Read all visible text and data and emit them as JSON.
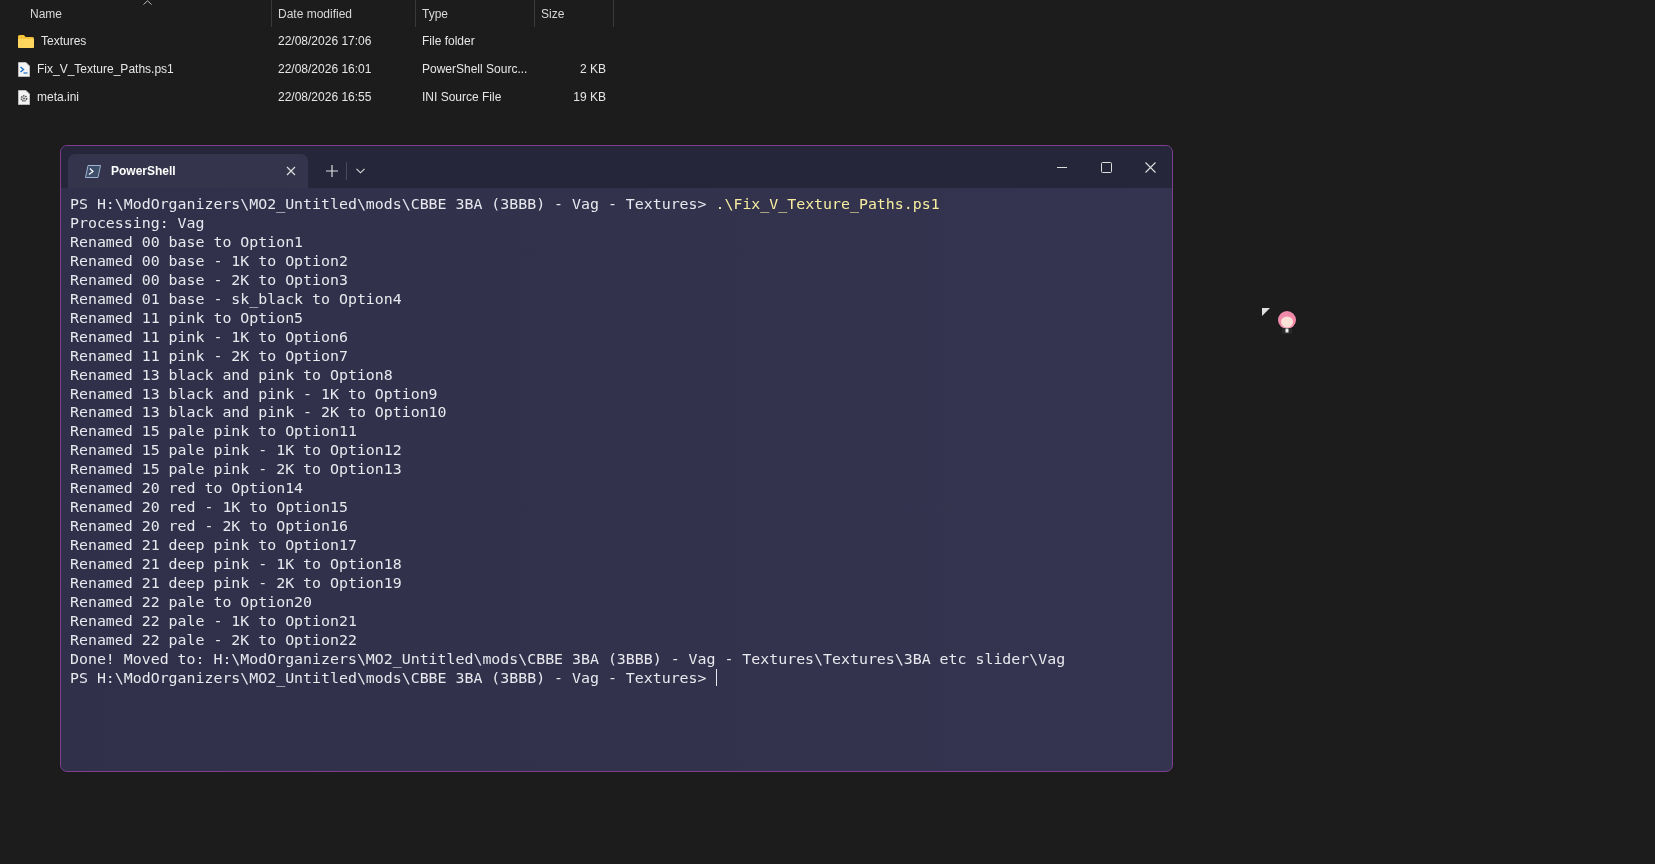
{
  "explorer": {
    "columns": [
      {
        "label": "Name",
        "sorted": true
      },
      {
        "label": "Date modified",
        "sorted": false
      },
      {
        "label": "Type",
        "sorted": false
      },
      {
        "label": "Size",
        "sorted": false
      }
    ],
    "rows": [
      {
        "kind": "folder",
        "name": "Textures",
        "date": "22/08/2026 17:06",
        "type": "File folder"
      },
      {
        "kind": "script",
        "name": "Fix_V_Texture_Paths.ps1",
        "date": "22/08/2026 16:01",
        "type": "PowerShell Sourc...",
        "size": "2 KB"
      },
      {
        "kind": "settings",
        "name": "meta.ini",
        "date": "22/08/2026 16:55",
        "type": "INI Source File",
        "size": "19 KB"
      }
    ]
  },
  "terminal": {
    "tab": {
      "title": "PowerShell",
      "selected": true
    },
    "lines": [
      {
        "kind": "prompt",
        "prompt": "PS H:\\ModOrganizers\\MO2_Untitled\\mods\\CBBE 3BA (3BBB) - Vag - Textures> ",
        "command": ".\\Fix_V_Texture_Paths.ps1",
        "cursor": false
      },
      {
        "kind": "output",
        "text": "Processing: Vag"
      },
      {
        "kind": "output",
        "text": "Renamed 00 base to Option1"
      },
      {
        "kind": "output",
        "text": "Renamed 00 base - 1K to Option2"
      },
      {
        "kind": "output",
        "text": "Renamed 00 base - 2K to Option3"
      },
      {
        "kind": "output",
        "text": "Renamed 01 base - sk_black to Option4"
      },
      {
        "kind": "output",
        "text": "Renamed 11 pink to Option5"
      },
      {
        "kind": "output",
        "text": "Renamed 11 pink - 1K to Option6"
      },
      {
        "kind": "output",
        "text": "Renamed 11 pink - 2K to Option7"
      },
      {
        "kind": "output",
        "text": "Renamed 13 black and pink to Option8"
      },
      {
        "kind": "output",
        "text": "Renamed 13 black and pink - 1K to Option9"
      },
      {
        "kind": "output",
        "text": "Renamed 13 black and pink - 2K to Option10"
      },
      {
        "kind": "output",
        "text": "Renamed 15 pale pink to Option11"
      },
      {
        "kind": "output",
        "text": "Renamed 15 pale pink - 1K to Option12"
      },
      {
        "kind": "output",
        "text": "Renamed 15 pale pink - 2K to Option13"
      },
      {
        "kind": "output",
        "text": "Renamed 20 red to Option14"
      },
      {
        "kind": "output",
        "text": "Renamed 20 red - 1K to Option15"
      },
      {
        "kind": "output",
        "text": "Renamed 20 red - 2K to Option16"
      },
      {
        "kind": "output",
        "text": "Renamed 21 deep pink to Option17"
      },
      {
        "kind": "output",
        "text": "Renamed 21 deep pink - 1K to Option18"
      },
      {
        "kind": "output",
        "text": "Renamed 21 deep pink - 2K to Option19"
      },
      {
        "kind": "output",
        "text": "Renamed 22 pale to Option20"
      },
      {
        "kind": "output",
        "text": "Renamed 22 pale - 1K to Option21"
      },
      {
        "kind": "output",
        "text": "Renamed 22 pale - 2K to Option22"
      },
      {
        "kind": "output",
        "text": "Done! Moved to: H:\\ModOrganizers\\MO2_Untitled\\mods\\CBBE 3BA (3BBB) - Vag - Textures\\Textures\\3BA etc slider\\Vag"
      },
      {
        "kind": "prompt",
        "prompt": "PS H:\\ModOrganizers\\MO2_Untitled\\mods\\CBBE 3BA (3BBB) - Vag - Textures> ",
        "cursor": true
      }
    ]
  }
}
